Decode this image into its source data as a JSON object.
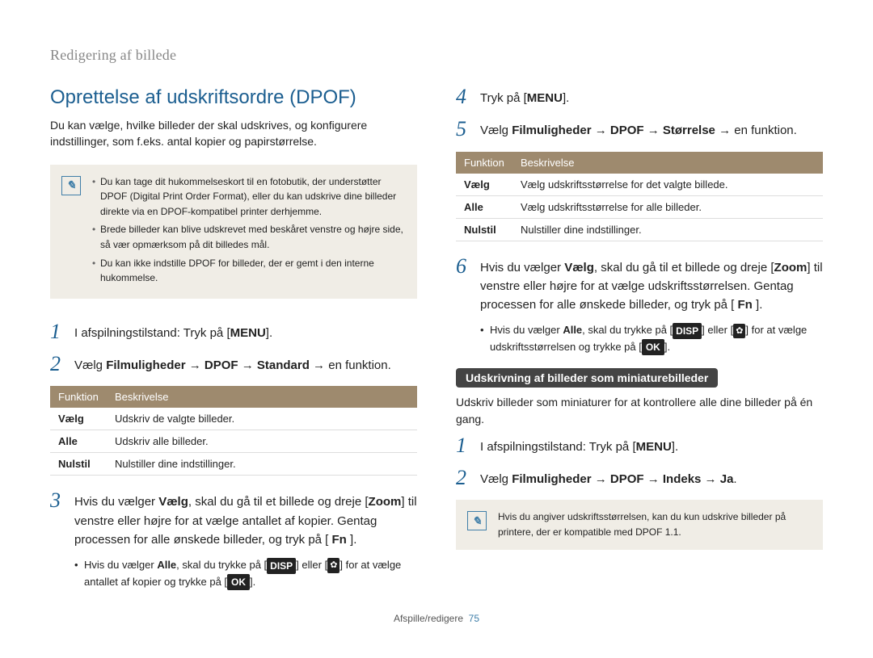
{
  "breadcrumb": "Redigering af billede",
  "section_title": "Oprettelse af udskriftsordre (DPOF)",
  "intro": "Du kan vælge, hvilke billeder der skal udskrives, og konfigurere indstillinger, som f.eks. antal kopier og papirstørrelse.",
  "note1": {
    "li1": "Du kan tage dit hukommelseskort til en fotobutik, der understøtter DPOF (Digital Print Order Format), eller du kan udskrive dine billeder direkte via en DPOF-kompatibel printer derhjemme.",
    "li2": "Brede billeder kan blive udskrevet med beskåret venstre og højre side, så vær opmærksom på dit billedes mål.",
    "li3": "Du kan ikke indstille DPOF for billeder, der er gemt i den interne hukommelse."
  },
  "buttons": {
    "menu": "MENU",
    "fn": "Fn",
    "disp": "DISP",
    "ok": "OK",
    "flower": "✿"
  },
  "left_steps": {
    "s1_pre": "I afspilningstilstand: Tryk på ",
    "s2_pre": "Vælg ",
    "s2_bold": "Filmuligheder → DPOF → Standard",
    "s2_post": " → en funktion.",
    "s3_a": "Hvis du vælger ",
    "s3_b": "Vælg",
    "s3_c": ", skal du gå til et billede og dreje [",
    "s3_d": "Zoom",
    "s3_e": "] til venstre eller højre for at vælge antallet af kopier. Gentag processen for alle ønskede billeder, og tryk på ",
    "s3_sub_a": "Hvis du vælger ",
    "s3_sub_b": "Alle",
    "s3_sub_c": ", skal du trykke på [",
    "s3_sub_d": "] eller [",
    "s3_sub_e": "] for at vælge antallet af kopier og trykke på [",
    "s3_sub_f": "]."
  },
  "table1": {
    "h1": "Funktion",
    "h2": "Beskrivelse",
    "r1c1": "Vælg",
    "r1c2": "Udskriv de valgte billeder.",
    "r2c1": "Alle",
    "r2c2": "Udskriv alle billeder.",
    "r3c1": "Nulstil",
    "r3c2": "Nulstiller dine indstillinger."
  },
  "right_steps": {
    "s4_pre": "Tryk på ",
    "s5_pre": "Vælg ",
    "s5_bold": "Filmuligheder → DPOF → Størrelse",
    "s5_post": " → en funktion.",
    "s6_a": "Hvis du vælger ",
    "s6_b": "Vælg",
    "s6_c": ", skal du gå til et billede og dreje [",
    "s6_d": "Zoom",
    "s6_e": "] til venstre eller højre for at vælge udskriftsstørrelsen. Gentag processen for alle ønskede billeder, og tryk på ",
    "s6_sub_a": "Hvis du vælger ",
    "s6_sub_b": "Alle",
    "s6_sub_c": ", skal du trykke på [",
    "s6_sub_d": "] eller [",
    "s6_sub_e": "] for at vælge udskriftsstørrelsen og trykke på [",
    "s6_sub_f": "]."
  },
  "table2": {
    "h1": "Funktion",
    "h2": "Beskrivelse",
    "r1c1": "Vælg",
    "r1c2": "Vælg udskriftsstørrelse for det valgte billede.",
    "r2c1": "Alle",
    "r2c2": "Vælg udskriftsstørrelse for alle billeder.",
    "r3c1": "Nulstil",
    "r3c2": "Nulstiller dine indstillinger."
  },
  "mini": {
    "pill": "Udskrivning af billeder som miniaturebilleder",
    "desc": "Udskriv billeder som miniaturer for at kontrollere alle dine billeder på én gang.",
    "s1_pre": "I afspilningstilstand: Tryk på ",
    "s2_pre": "Vælg ",
    "s2_bold": "Filmuligheder → DPOF → Indeks → Ja",
    "s2_post": "."
  },
  "note2": "Hvis du angiver udskriftsstørrelsen, kan du kun udskrive billeder på printere, der er kompatible med DPOF 1.1.",
  "footer": {
    "section": "Afspille/redigere",
    "page": "75"
  },
  "numbers": {
    "n1": "1",
    "n2": "2",
    "n3": "3",
    "n4": "4",
    "n5": "5",
    "n6": "6"
  }
}
